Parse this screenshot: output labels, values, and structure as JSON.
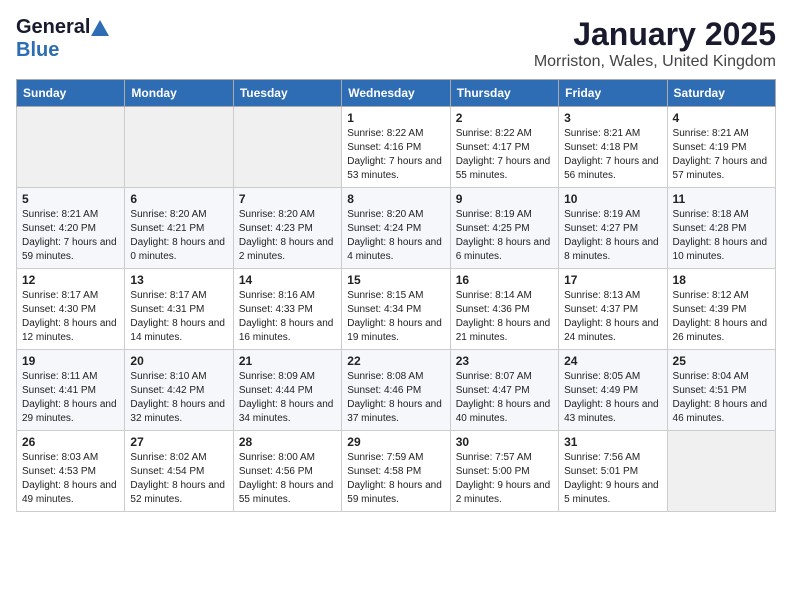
{
  "header": {
    "logo_general": "General",
    "logo_blue": "Blue",
    "month_title": "January 2025",
    "location": "Morriston, Wales, United Kingdom"
  },
  "weekdays": [
    "Sunday",
    "Monday",
    "Tuesday",
    "Wednesday",
    "Thursday",
    "Friday",
    "Saturday"
  ],
  "weeks": [
    [
      {
        "day": "",
        "sunrise": "",
        "sunset": "",
        "daylight": ""
      },
      {
        "day": "",
        "sunrise": "",
        "sunset": "",
        "daylight": ""
      },
      {
        "day": "",
        "sunrise": "",
        "sunset": "",
        "daylight": ""
      },
      {
        "day": "1",
        "sunrise": "Sunrise: 8:22 AM",
        "sunset": "Sunset: 4:16 PM",
        "daylight": "Daylight: 7 hours and 53 minutes."
      },
      {
        "day": "2",
        "sunrise": "Sunrise: 8:22 AM",
        "sunset": "Sunset: 4:17 PM",
        "daylight": "Daylight: 7 hours and 55 minutes."
      },
      {
        "day": "3",
        "sunrise": "Sunrise: 8:21 AM",
        "sunset": "Sunset: 4:18 PM",
        "daylight": "Daylight: 7 hours and 56 minutes."
      },
      {
        "day": "4",
        "sunrise": "Sunrise: 8:21 AM",
        "sunset": "Sunset: 4:19 PM",
        "daylight": "Daylight: 7 hours and 57 minutes."
      }
    ],
    [
      {
        "day": "5",
        "sunrise": "Sunrise: 8:21 AM",
        "sunset": "Sunset: 4:20 PM",
        "daylight": "Daylight: 7 hours and 59 minutes."
      },
      {
        "day": "6",
        "sunrise": "Sunrise: 8:20 AM",
        "sunset": "Sunset: 4:21 PM",
        "daylight": "Daylight: 8 hours and 0 minutes."
      },
      {
        "day": "7",
        "sunrise": "Sunrise: 8:20 AM",
        "sunset": "Sunset: 4:23 PM",
        "daylight": "Daylight: 8 hours and 2 minutes."
      },
      {
        "day": "8",
        "sunrise": "Sunrise: 8:20 AM",
        "sunset": "Sunset: 4:24 PM",
        "daylight": "Daylight: 8 hours and 4 minutes."
      },
      {
        "day": "9",
        "sunrise": "Sunrise: 8:19 AM",
        "sunset": "Sunset: 4:25 PM",
        "daylight": "Daylight: 8 hours and 6 minutes."
      },
      {
        "day": "10",
        "sunrise": "Sunrise: 8:19 AM",
        "sunset": "Sunset: 4:27 PM",
        "daylight": "Daylight: 8 hours and 8 minutes."
      },
      {
        "day": "11",
        "sunrise": "Sunrise: 8:18 AM",
        "sunset": "Sunset: 4:28 PM",
        "daylight": "Daylight: 8 hours and 10 minutes."
      }
    ],
    [
      {
        "day": "12",
        "sunrise": "Sunrise: 8:17 AM",
        "sunset": "Sunset: 4:30 PM",
        "daylight": "Daylight: 8 hours and 12 minutes."
      },
      {
        "day": "13",
        "sunrise": "Sunrise: 8:17 AM",
        "sunset": "Sunset: 4:31 PM",
        "daylight": "Daylight: 8 hours and 14 minutes."
      },
      {
        "day": "14",
        "sunrise": "Sunrise: 8:16 AM",
        "sunset": "Sunset: 4:33 PM",
        "daylight": "Daylight: 8 hours and 16 minutes."
      },
      {
        "day": "15",
        "sunrise": "Sunrise: 8:15 AM",
        "sunset": "Sunset: 4:34 PM",
        "daylight": "Daylight: 8 hours and 19 minutes."
      },
      {
        "day": "16",
        "sunrise": "Sunrise: 8:14 AM",
        "sunset": "Sunset: 4:36 PM",
        "daylight": "Daylight: 8 hours and 21 minutes."
      },
      {
        "day": "17",
        "sunrise": "Sunrise: 8:13 AM",
        "sunset": "Sunset: 4:37 PM",
        "daylight": "Daylight: 8 hours and 24 minutes."
      },
      {
        "day": "18",
        "sunrise": "Sunrise: 8:12 AM",
        "sunset": "Sunset: 4:39 PM",
        "daylight": "Daylight: 8 hours and 26 minutes."
      }
    ],
    [
      {
        "day": "19",
        "sunrise": "Sunrise: 8:11 AM",
        "sunset": "Sunset: 4:41 PM",
        "daylight": "Daylight: 8 hours and 29 minutes."
      },
      {
        "day": "20",
        "sunrise": "Sunrise: 8:10 AM",
        "sunset": "Sunset: 4:42 PM",
        "daylight": "Daylight: 8 hours and 32 minutes."
      },
      {
        "day": "21",
        "sunrise": "Sunrise: 8:09 AM",
        "sunset": "Sunset: 4:44 PM",
        "daylight": "Daylight: 8 hours and 34 minutes."
      },
      {
        "day": "22",
        "sunrise": "Sunrise: 8:08 AM",
        "sunset": "Sunset: 4:46 PM",
        "daylight": "Daylight: 8 hours and 37 minutes."
      },
      {
        "day": "23",
        "sunrise": "Sunrise: 8:07 AM",
        "sunset": "Sunset: 4:47 PM",
        "daylight": "Daylight: 8 hours and 40 minutes."
      },
      {
        "day": "24",
        "sunrise": "Sunrise: 8:05 AM",
        "sunset": "Sunset: 4:49 PM",
        "daylight": "Daylight: 8 hours and 43 minutes."
      },
      {
        "day": "25",
        "sunrise": "Sunrise: 8:04 AM",
        "sunset": "Sunset: 4:51 PM",
        "daylight": "Daylight: 8 hours and 46 minutes."
      }
    ],
    [
      {
        "day": "26",
        "sunrise": "Sunrise: 8:03 AM",
        "sunset": "Sunset: 4:53 PM",
        "daylight": "Daylight: 8 hours and 49 minutes."
      },
      {
        "day": "27",
        "sunrise": "Sunrise: 8:02 AM",
        "sunset": "Sunset: 4:54 PM",
        "daylight": "Daylight: 8 hours and 52 minutes."
      },
      {
        "day": "28",
        "sunrise": "Sunrise: 8:00 AM",
        "sunset": "Sunset: 4:56 PM",
        "daylight": "Daylight: 8 hours and 55 minutes."
      },
      {
        "day": "29",
        "sunrise": "Sunrise: 7:59 AM",
        "sunset": "Sunset: 4:58 PM",
        "daylight": "Daylight: 8 hours and 59 minutes."
      },
      {
        "day": "30",
        "sunrise": "Sunrise: 7:57 AM",
        "sunset": "Sunset: 5:00 PM",
        "daylight": "Daylight: 9 hours and 2 minutes."
      },
      {
        "day": "31",
        "sunrise": "Sunrise: 7:56 AM",
        "sunset": "Sunset: 5:01 PM",
        "daylight": "Daylight: 9 hours and 5 minutes."
      },
      {
        "day": "",
        "sunrise": "",
        "sunset": "",
        "daylight": ""
      }
    ]
  ]
}
